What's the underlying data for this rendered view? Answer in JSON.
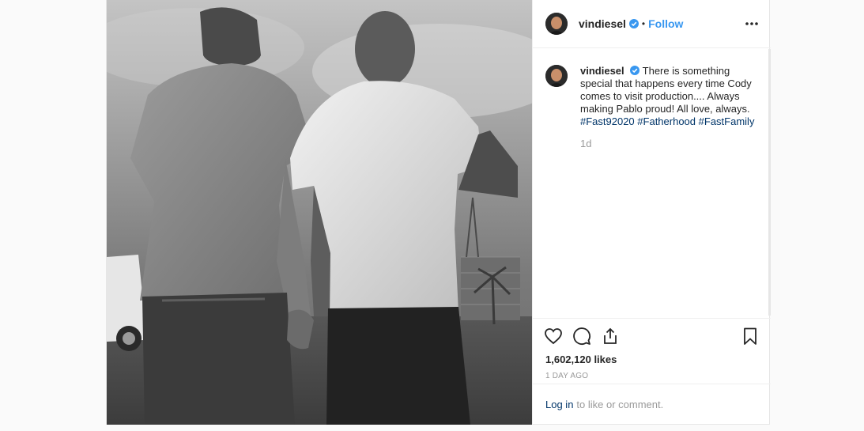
{
  "post": {
    "photo_alt": "photo",
    "header": {
      "username": "vindiesel",
      "separator": "•",
      "follow_label": "Follow",
      "more_icon": "more-horizontal-icon"
    },
    "caption": {
      "username": "vindiesel",
      "text": "There is something special that happens every time Cody comes to visit production.... Always making Pablo proud! All love, always.",
      "hashtags": [
        "#Fast92020",
        "#Fatherhood",
        "#FastFamily"
      ],
      "age": "1d"
    },
    "actions": {
      "icons": [
        "heart-icon",
        "comment-icon",
        "share-icon",
        "bookmark-icon"
      ]
    },
    "likes": "1,602,120 likes",
    "timestamp": "1 DAY AGO",
    "login": {
      "link": "Log in",
      "text": "to like or comment."
    }
  },
  "colors": {
    "accent": "#3897f0",
    "hashtag": "#003569",
    "muted": "#999999",
    "border": "#efefef"
  }
}
